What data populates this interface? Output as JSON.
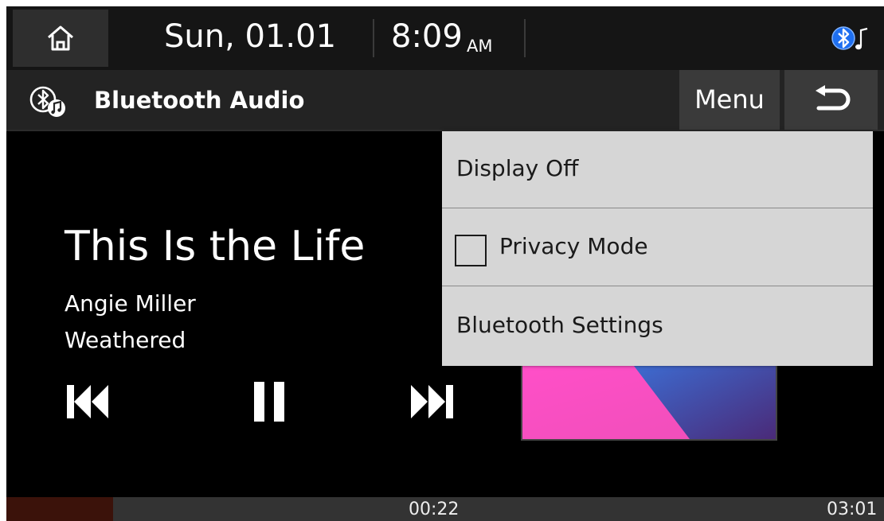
{
  "status_bar": {
    "date": "Sun, 01.01",
    "time": "8:09",
    "ampm": "AM",
    "bluetooth_status_icon": "bluetooth-audio-connected-icon"
  },
  "header": {
    "title": "Bluetooth Audio",
    "menu_label": "Menu",
    "icon": "bluetooth-music-icon"
  },
  "track": {
    "title": "This Is the Life",
    "artist": "Angie Miller",
    "album": "Weathered"
  },
  "controls": {
    "prev_icon": "skip-previous-icon",
    "pause_icon": "pause-icon",
    "next_icon": "skip-next-icon"
  },
  "playback": {
    "elapsed": "00:22",
    "total": "03:01",
    "progress_fraction": 0.1215
  },
  "menu": {
    "items": [
      {
        "label": "Display Off"
      },
      {
        "label": "Privacy Mode",
        "checkbox": true,
        "checked": false
      },
      {
        "label": "Bluetooth Settings"
      }
    ]
  },
  "colors": {
    "background": "#000000",
    "menu_background": "#d6d6d6",
    "progress_fill": "#3b120a",
    "bluetooth_blue": "#1e6ff0"
  }
}
